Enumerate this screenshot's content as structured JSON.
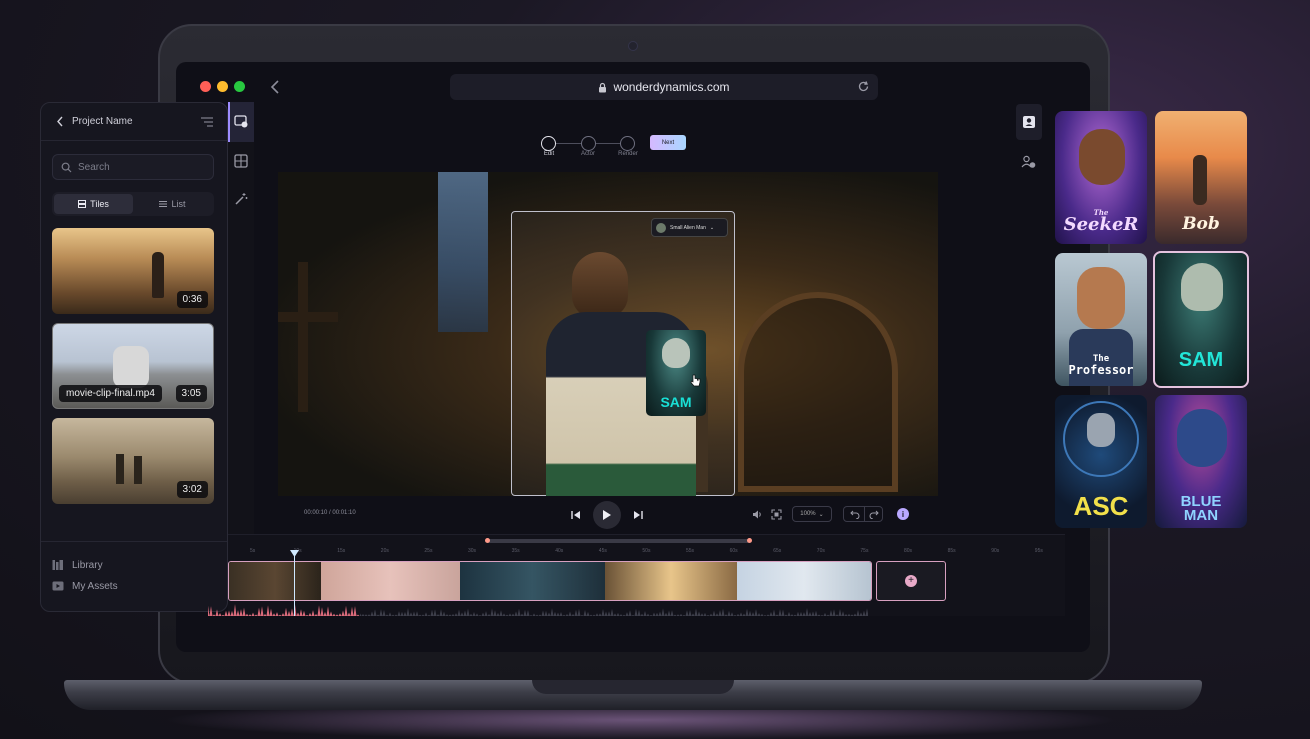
{
  "browser": {
    "url": "wonderdynamics.com"
  },
  "sidebar": {
    "project_name": "Project Name",
    "search_placeholder": "Search",
    "view_tabs": [
      {
        "label": "Tiles"
      },
      {
        "label": "List"
      }
    ],
    "clips": [
      {
        "duration": "0:36"
      },
      {
        "name": "movie-clip-final.mp4",
        "duration": "3:05"
      },
      {
        "duration": "3:02"
      }
    ],
    "footer": [
      {
        "label": "Library"
      },
      {
        "label": "My Assets"
      }
    ]
  },
  "stepper": {
    "steps": [
      {
        "label": "Edit"
      },
      {
        "label": "Actor"
      },
      {
        "label": "Render"
      }
    ],
    "next_label": "Next"
  },
  "editor": {
    "character_chip": "Small Alien Man",
    "overlay_card_name": "SAM",
    "time_current": "00:00:10",
    "time_total": "00:01:10",
    "time_separator": "/",
    "zoom": "100%"
  },
  "timeline": {
    "ticks": [
      "5s",
      "10s",
      "15s",
      "20s",
      "25s",
      "30s",
      "35s",
      "40s",
      "45s",
      "50s",
      "55s",
      "60s",
      "65s",
      "70s",
      "75s",
      "80s",
      "85s",
      "90s",
      "95s"
    ],
    "add_symbol": "+"
  },
  "characters": [
    {
      "name": "The SeekeR",
      "line1": "The",
      "line2": "SeekeR",
      "selected": false
    },
    {
      "name": "Bob",
      "line1": "",
      "line2": "Bob",
      "selected": false
    },
    {
      "name": "The Professor",
      "line1": "The",
      "line2": "Professor",
      "selected": false
    },
    {
      "name": "SAM",
      "line1": "",
      "line2": "SAM",
      "selected": true
    },
    {
      "name": "ASC",
      "line1": "",
      "line2": "ASC",
      "selected": false
    },
    {
      "name": "BLUE MAN",
      "line1": "BLUE",
      "line2": "MAN",
      "selected": false
    }
  ],
  "colors": {
    "accent": "#9d8cff",
    "selection": "#d7a0c0",
    "next_gradient_start": "#d5b9ff",
    "next_gradient_end": "#a9d6ff"
  }
}
